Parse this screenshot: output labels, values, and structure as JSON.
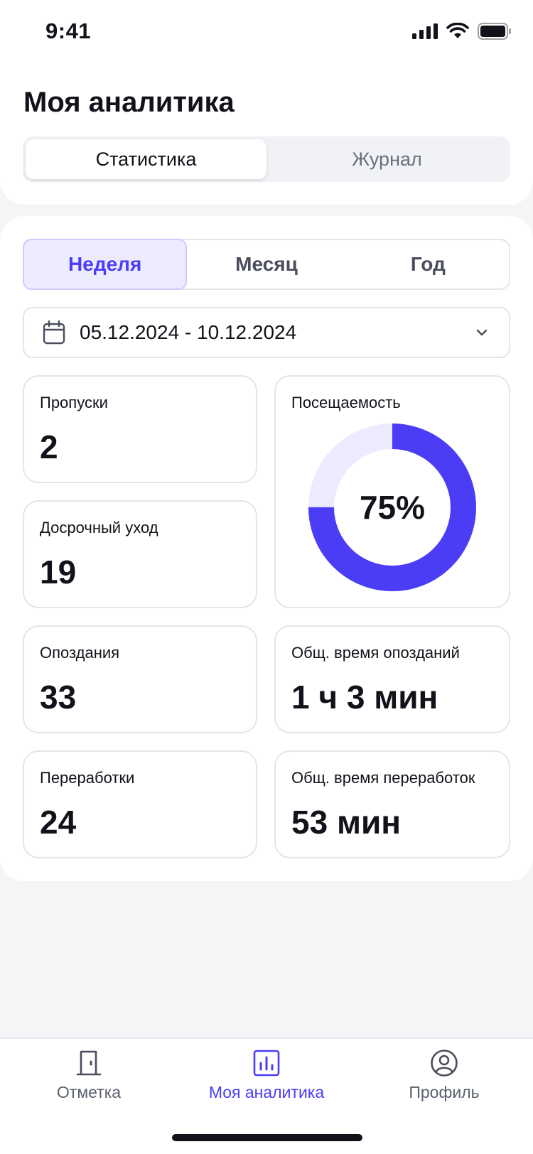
{
  "status": {
    "time": "9:41"
  },
  "header": {
    "title": "Моя аналитика",
    "tabs": [
      {
        "label": "Статистика",
        "active": true
      },
      {
        "label": "Журнал",
        "active": false
      }
    ]
  },
  "period": {
    "options": [
      {
        "label": "Неделя",
        "active": true
      },
      {
        "label": "Месяц",
        "active": false
      },
      {
        "label": "Год",
        "active": false
      }
    ]
  },
  "date_range": {
    "value": "05.12.2024 - 10.12.2024",
    "icon": "calendar-icon"
  },
  "stats": {
    "absences": {
      "label": "Пропуски",
      "value": "2"
    },
    "early_leave": {
      "label": "Досрочный уход",
      "value": "19"
    },
    "attendance": {
      "label": "Посещаемость",
      "value": "75%",
      "fraction": 0.75
    },
    "lates": {
      "label": "Опоздания",
      "value": "33"
    },
    "late_time": {
      "label": "Общ. время опозданий",
      "value": "1 ч 3 мин"
    },
    "overtimes": {
      "label": "Переработки",
      "value": "24"
    },
    "overtime_time": {
      "label": "Общ. время переработок",
      "value": "53 мин"
    }
  },
  "colors": {
    "accent": "#4A3DF5",
    "accent_light": "#ECEBFF",
    "text": "#12131A",
    "muted": "#5B5F70"
  },
  "tabbar": {
    "items": [
      {
        "label": "Отметка",
        "icon": "door-icon",
        "active": false
      },
      {
        "label": "Моя аналитика",
        "icon": "chart-icon",
        "active": true
      },
      {
        "label": "Профиль",
        "icon": "profile-icon",
        "active": false
      }
    ]
  }
}
